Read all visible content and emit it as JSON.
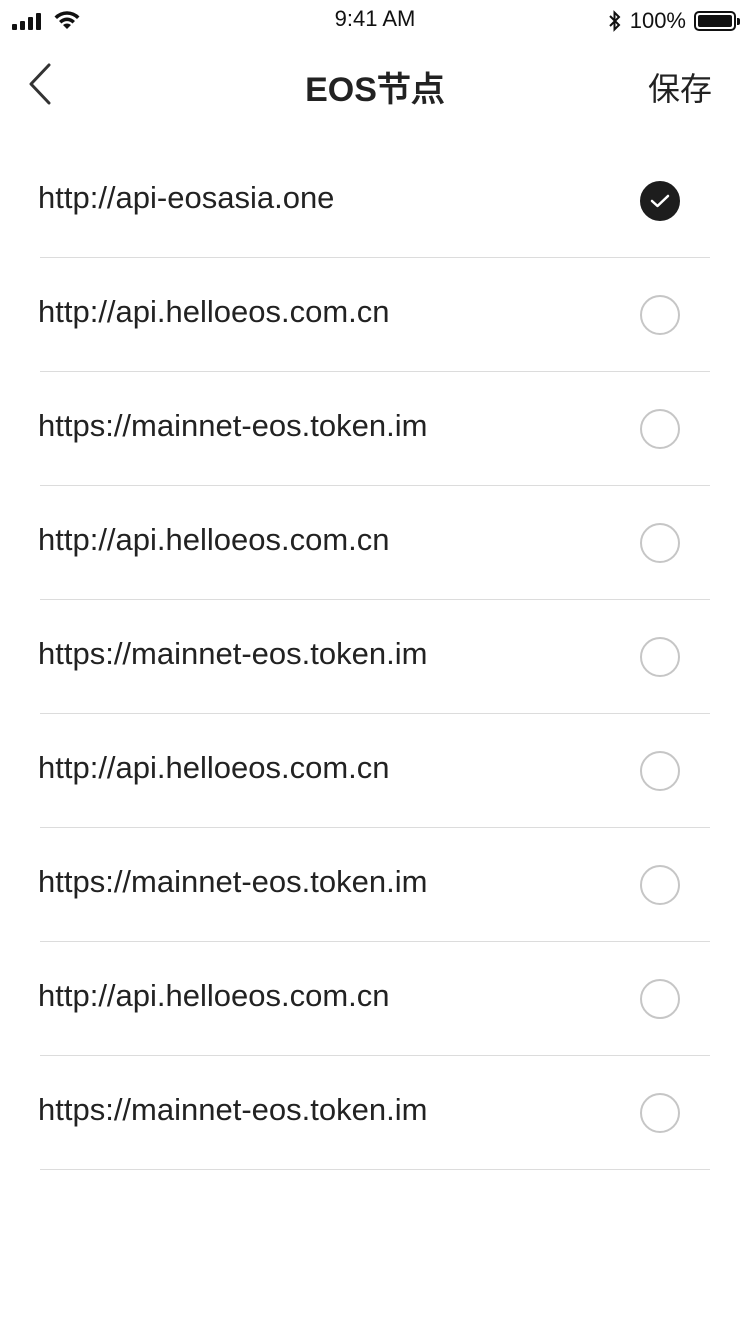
{
  "status_bar": {
    "time": "9:41 AM",
    "battery": "100%",
    "icons": [
      "signal-icon",
      "wifi-icon",
      "bluetooth-icon",
      "battery-icon"
    ]
  },
  "nav": {
    "back_icon": "chevron-left-icon",
    "title": "EOS节点",
    "save_label": "保存"
  },
  "nodes": [
    {
      "url": "http://api-eosasia.one",
      "selected": true
    },
    {
      "url": "http://api.helloeos.com.cn",
      "selected": false
    },
    {
      "url": "https://mainnet-eos.token.im",
      "selected": false
    },
    {
      "url": "http://api.helloeos.com.cn",
      "selected": false
    },
    {
      "url": "https://mainnet-eos.token.im",
      "selected": false
    },
    {
      "url": "http://api.helloeos.com.cn",
      "selected": false
    },
    {
      "url": "https://mainnet-eos.token.im",
      "selected": false
    },
    {
      "url": "http://api.helloeos.com.cn",
      "selected": false
    },
    {
      "url": "https://mainnet-eos.token.im",
      "selected": false
    }
  ],
  "colors": {
    "selected": "#1d1d1d",
    "unselected_border": "#c6c6c6",
    "divider": "#dcdcdc"
  }
}
